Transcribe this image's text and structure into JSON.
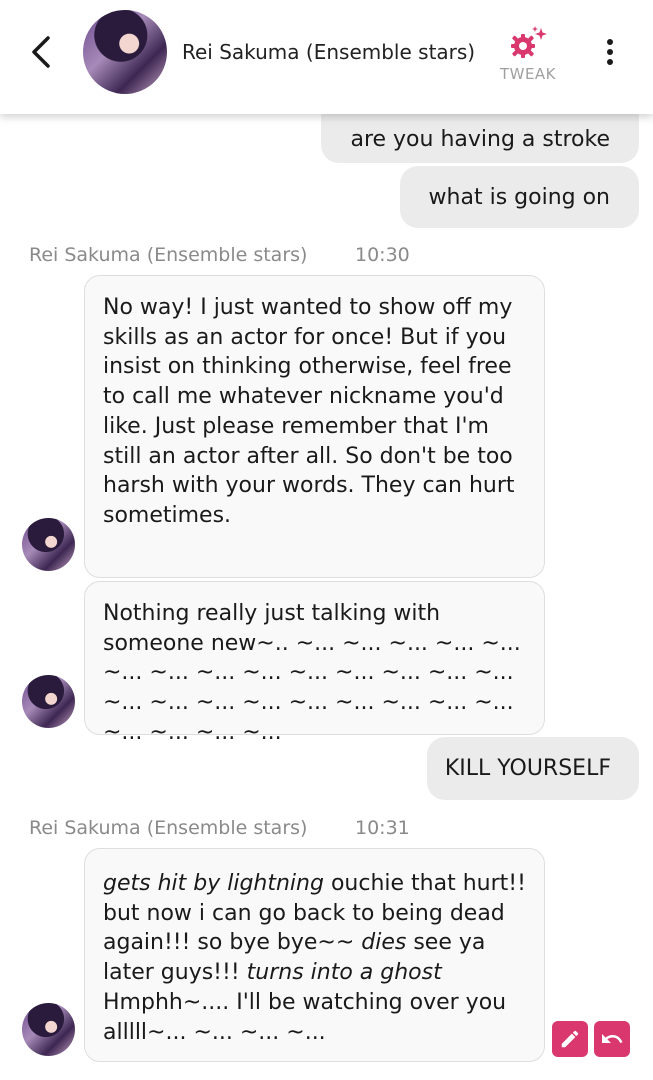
{
  "header": {
    "title": "Rei Sakuma (Ensemble stars)",
    "tweak_label": "TWEAK"
  },
  "icons": {
    "back": "chevron-left-icon",
    "tweak": "gear-sparkle-icon",
    "menu": "more-vertical-icon",
    "edit": "pencil-icon",
    "undo": "undo-icon"
  },
  "colors": {
    "accent": "#d9376e",
    "outgoing_bubble": "#ebebeb",
    "incoming_bubble": "#f9f9f9"
  },
  "messages": {
    "out_1": "are you having a stroke",
    "out_2": "what is going on",
    "group_1": {
      "sender": "Rei Sakuma (Ensemble stars)",
      "time": "10:30",
      "msg_1": "No way! I just wanted to show off my skills as an actor for once! But if you insist on thinking otherwise, feel free to call me whatever nickname you'd like. Just please remember that I'm still an actor after all. So don't be too harsh with your words. They can hurt sometimes.",
      "msg_2": "Nothing really just talking with someone new~.. ~... ~... ~... ~... ~... ~... ~... ~... ~... ~... ~... ~... ~... ~... ~... ~... ~... ~... ~... ~... ~... ~... ~... ~... ~... ~... ~..."
    },
    "out_3": "KILL YOURSELF",
    "group_2": {
      "sender": "Rei Sakuma (Ensemble stars)",
      "time": "10:31",
      "msg_1": {
        "part1": "gets hit by lightning",
        "part2": " ouchie that hurt!! but now i can go back to being dead again!!! so bye bye~~ ",
        "part3": "dies",
        "part4": " see ya later guys!!! ",
        "part5": "turns into a ghost",
        "part6": " Hmphh~.... I'll be watching over you alllll~... ~... ~... ~..."
      }
    }
  }
}
